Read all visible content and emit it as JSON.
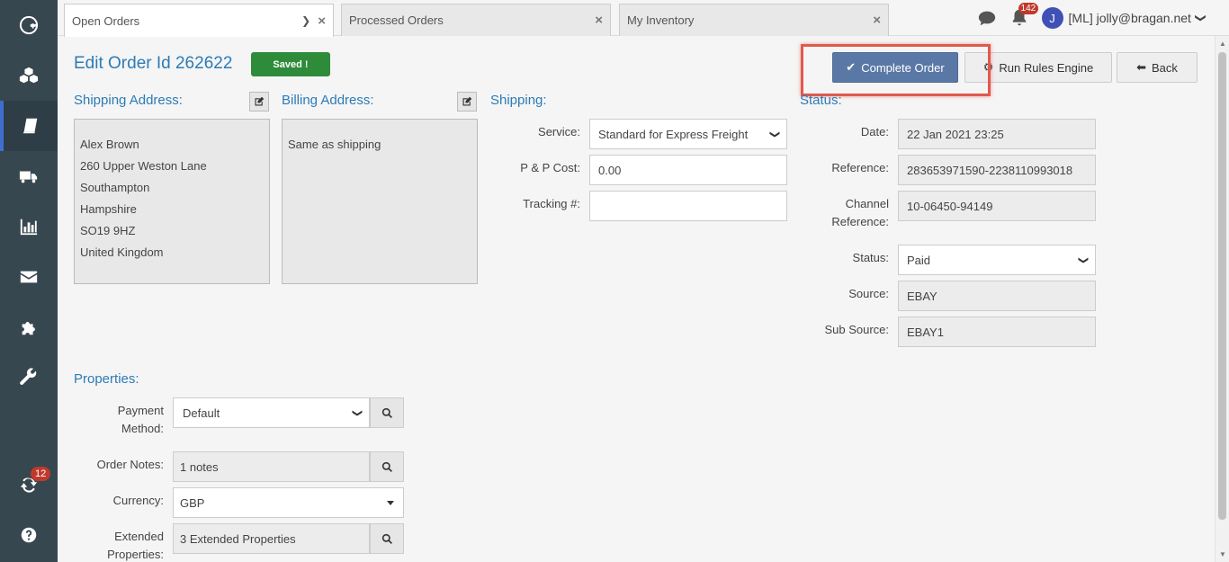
{
  "sidebar": {
    "items": [
      {
        "icon": "logo-icon"
      },
      {
        "icon": "cubes-icon"
      },
      {
        "icon": "book-icon",
        "active": true
      },
      {
        "icon": "truck-icon"
      },
      {
        "icon": "chart-icon"
      },
      {
        "icon": "envelope-icon"
      },
      {
        "icon": "puzzle-icon"
      },
      {
        "icon": "wrench-icon"
      },
      {
        "icon": "sync-icon",
        "badge": "12"
      },
      {
        "icon": "help-icon"
      }
    ]
  },
  "tabs": [
    {
      "label": "Open Orders",
      "active": true
    },
    {
      "label": "Processed Orders"
    },
    {
      "label": "My Inventory"
    }
  ],
  "header": {
    "notification_count": "142",
    "avatar_initial": "J",
    "user": "[ML] jolly@bragan.net"
  },
  "order": {
    "title": "Edit Order Id 262622",
    "saved_label": "Saved !"
  },
  "actions": {
    "complete": "Complete Order",
    "rules": "Run Rules Engine",
    "back": "Back"
  },
  "shipping_address": {
    "heading": "Shipping Address:",
    "lines": [
      "Alex Brown",
      "260 Upper Weston Lane",
      "Southampton",
      "Hampshire",
      "SO19 9HZ",
      "United Kingdom"
    ]
  },
  "billing_address": {
    "heading": "Billing Address:",
    "text": "Same as shipping"
  },
  "shipping": {
    "heading": "Shipping:",
    "service_label": "Service:",
    "service_value": "Standard for Express Freight",
    "pp_cost_label": "P & P Cost:",
    "pp_cost_value": "0.00",
    "tracking_label": "Tracking #:",
    "tracking_value": ""
  },
  "status": {
    "heading": "Status:",
    "date_label": "Date:",
    "date_value": "22 Jan 2021 23:25",
    "reference_label": "Reference:",
    "reference_value": "283653971590-2238110993018",
    "channel_ref_label_1": "Channel",
    "channel_ref_label_2": "Reference:",
    "channel_ref_value": "10-06450-94149",
    "status_label": "Status:",
    "status_value": "Paid",
    "source_label": "Source:",
    "source_value": "EBAY",
    "sub_source_label": "Sub Source:",
    "sub_source_value": "EBAY1"
  },
  "properties": {
    "heading": "Properties:",
    "payment_label_1": "Payment",
    "payment_label_2": "Method:",
    "payment_value": "Default",
    "notes_label": "Order Notes:",
    "notes_value": "1 notes",
    "currency_label": "Currency:",
    "currency_value": "GBP",
    "ext_label_1": "Extended",
    "ext_label_2": "Properties:",
    "ext_value": "3 Extended Properties"
  }
}
